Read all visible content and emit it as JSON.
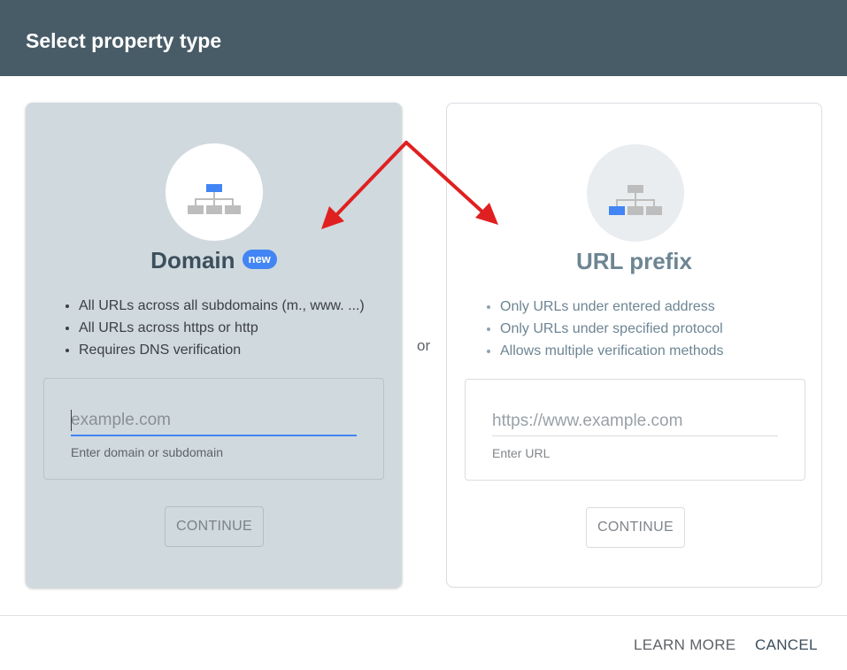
{
  "dialog": {
    "title": "Select property type"
  },
  "domain_card": {
    "icon": "sitemap-icon",
    "title": "Domain",
    "badge": "new",
    "features": [
      "All URLs across all subdomains (m., www. ...)",
      "All URLs across https or http",
      "Requires DNS verification"
    ],
    "input_placeholder": "example.com",
    "input_value": "",
    "helper_text": "Enter domain or subdomain",
    "continue_label": "CONTINUE"
  },
  "separator": "or",
  "url_card": {
    "icon": "sitemap-icon",
    "title": "URL prefix",
    "features": [
      "Only URLs under entered address",
      "Only URLs under specified protocol",
      "Allows multiple verification methods"
    ],
    "input_placeholder": "https://www.example.com",
    "input_value": "",
    "helper_text": "Enter URL",
    "continue_label": "CONTINUE"
  },
  "footer": {
    "learn_more_label": "LEARN MORE",
    "cancel_label": "CANCEL"
  },
  "colors": {
    "header_bg": "#485c68",
    "accent_blue": "#4285f4",
    "annotation_arrow": "#e02020"
  }
}
